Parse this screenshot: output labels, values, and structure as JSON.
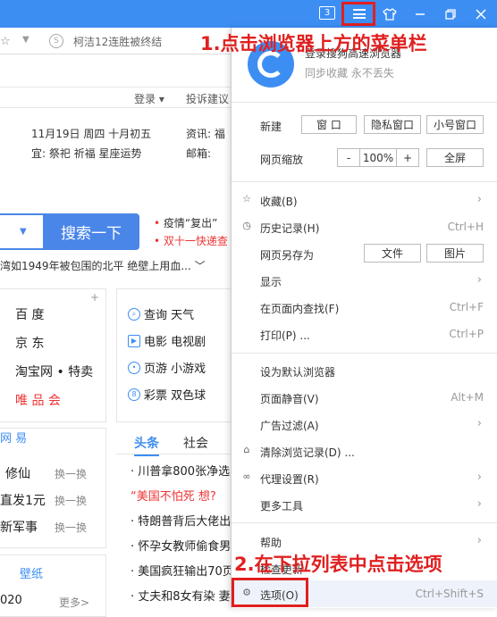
{
  "titlebar": {
    "tab_count": "3"
  },
  "addrbar": {
    "text": "柯洁12连胜被终结",
    "s_icon": "S"
  },
  "page": {
    "login": "登录",
    "complain": "投诉建议",
    "date": "11月19日  周四  十月初五",
    "yi": "宜: 祭祀 祈福  星座运势",
    "zixun": "资讯: 福",
    "youxiang": "邮箱:",
    "search_btn": "搜索一下",
    "news1": "疫情“复出”",
    "news2": "双十一快递查",
    "hot_line": "湾如1949年被包围的北平  绝壁上用血...",
    "sites": [
      "百  度",
      "京  东",
      "淘宝网 • 特卖",
      "唯 品 会"
    ],
    "services": [
      {
        "icon": "search-icon",
        "label": "查询  天气"
      },
      {
        "icon": "play-icon",
        "label": "电影  电视剧"
      },
      {
        "icon": "gamepad-icon",
        "label": "页游  小游戏"
      },
      {
        "icon": "lottery-icon",
        "label": "彩票  双色球"
      }
    ],
    "wangyi": "网 易",
    "left_rows": [
      {
        "label": "修仙",
        "swap": "换一换"
      },
      {
        "label": "直发1元",
        "swap": "换一换"
      },
      {
        "label": "新军事",
        "swap": "换一换"
      }
    ],
    "wall_title": "壁纸",
    "wall_2020": "020",
    "wall_more": "更多>",
    "tab_headline": "头条",
    "tab_society": "社会",
    "news": [
      {
        "text": "· 川普拿800张净选",
        "red": false
      },
      {
        "text": "  “美国不怕死 想?",
        "red": true
      },
      {
        "text": "· 特朗普背后大佬出",
        "red": false
      },
      {
        "text": "· 怀孕女教师偷食男",
        "red": false
      },
      {
        "text": "· 美国疯狂输出70页",
        "red": false
      },
      {
        "text": "· 丈夫和8女有染 妻",
        "red": false
      }
    ]
  },
  "annotations": {
    "step1": "1.点击浏览器上方的菜单栏",
    "step2": "2.在下拉列表中点击选项"
  },
  "menu": {
    "login": "登录搜狗高速浏览器",
    "sync": "同步收藏 永不丢失",
    "new_label": "新建",
    "new_window": "窗 口",
    "private_window": "隐私窗口",
    "small_window": "小号窗口",
    "zoom_label": "网页缩放",
    "zoom_minus": "-",
    "zoom_value": "100%",
    "zoom_plus": "+",
    "fullscreen": "全屏",
    "favorites": "收藏(B)",
    "history": "历史记录(H)",
    "history_shortcut": "Ctrl+H",
    "save_as": "网页另存为",
    "save_file": "文件",
    "save_image": "图片",
    "display": "显示",
    "find": "在页面内查找(F)",
    "find_shortcut": "Ctrl+F",
    "print": "打印(P) ...",
    "print_shortcut": "Ctrl+P",
    "set_default": "设为默认浏览器",
    "mute": "页面静音(V)",
    "mute_shortcut": "Alt+M",
    "adblock": "广告过滤(A)",
    "clear": "清除浏览记录(D) ...",
    "proxy": "代理设置(R)",
    "more_tools": "更多工具",
    "help": "帮助",
    "check_update": "检查更新",
    "options": "选项(O)",
    "options_shortcut": "Ctrl+Shift+S"
  }
}
